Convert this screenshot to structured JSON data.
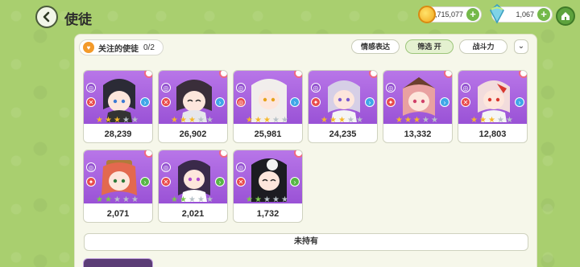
{
  "header": {
    "title": "使徒",
    "gold_amount": "1,715,077",
    "gem_amount": "1,067"
  },
  "panel": {
    "follow_label": "关注的使徒",
    "follow_count": "0/2",
    "buttons": [
      {
        "label": "情感表达"
      },
      {
        "label": "筛选 开"
      },
      {
        "label": "战斗力"
      }
    ],
    "not_owned_label": "未持有"
  },
  "cards": [
    {
      "power": "28,239",
      "stars": 5,
      "star_color": "gold",
      "hair": "#2b2b36",
      "element": "blue"
    },
    {
      "power": "26,902",
      "stars": 5,
      "star_color": "gold",
      "hair": "#3a2e3a",
      "element": "blue"
    },
    {
      "power": "25,981",
      "stars": 5,
      "star_color": "gold",
      "hair": "#f1eeec",
      "element": "blue"
    },
    {
      "power": "24,235",
      "stars": 5,
      "star_color": "gold",
      "hair": "#d6cfe6",
      "element": "blue"
    },
    {
      "power": "13,332",
      "stars": 5,
      "star_color": "gold",
      "hair": "#e9a1a1",
      "element": "blue"
    },
    {
      "power": "12,803",
      "stars": 5,
      "star_color": "gold",
      "hair": "#f2dcdc",
      "element": "blue"
    },
    {
      "power": "2,071",
      "stars": 5,
      "star_color": "green",
      "hair": "#e3694f",
      "element": "green"
    },
    {
      "power": "2,021",
      "stars": 5,
      "star_color": "green",
      "hair": "#3a2a4a",
      "element": "green"
    },
    {
      "power": "1,732",
      "stars": 5,
      "star_color": "green",
      "hair": "#1c1c22",
      "element": "green"
    }
  ]
}
